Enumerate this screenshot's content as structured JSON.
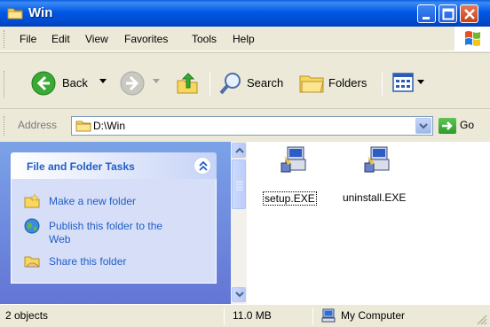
{
  "window": {
    "title": "Win",
    "title_icon": "folder-icon"
  },
  "menu": {
    "items": [
      "File",
      "Edit",
      "View",
      "Favorites",
      "Tools",
      "Help"
    ]
  },
  "toolbar": {
    "back_label": "Back",
    "search_label": "Search",
    "folders_label": "Folders"
  },
  "address": {
    "label": "Address",
    "value": "D:\\Win",
    "go_label": "Go"
  },
  "tasks": {
    "title": "File and Folder Tasks",
    "items": [
      "Make a new folder",
      "Publish this folder to the Web",
      "Share this folder"
    ]
  },
  "files": [
    {
      "name": "setup.EXE",
      "selected": true
    },
    {
      "name": "uninstall.EXE",
      "selected": false
    }
  ],
  "status": {
    "objects": "2 objects",
    "size": "11.0 MB",
    "location": "My Computer"
  },
  "colors": {
    "titlebar": "#0054E3",
    "task_link": "#215DC6",
    "pane_gradient_top": "#7BA2E7",
    "pane_gradient_bottom": "#6375D6"
  }
}
